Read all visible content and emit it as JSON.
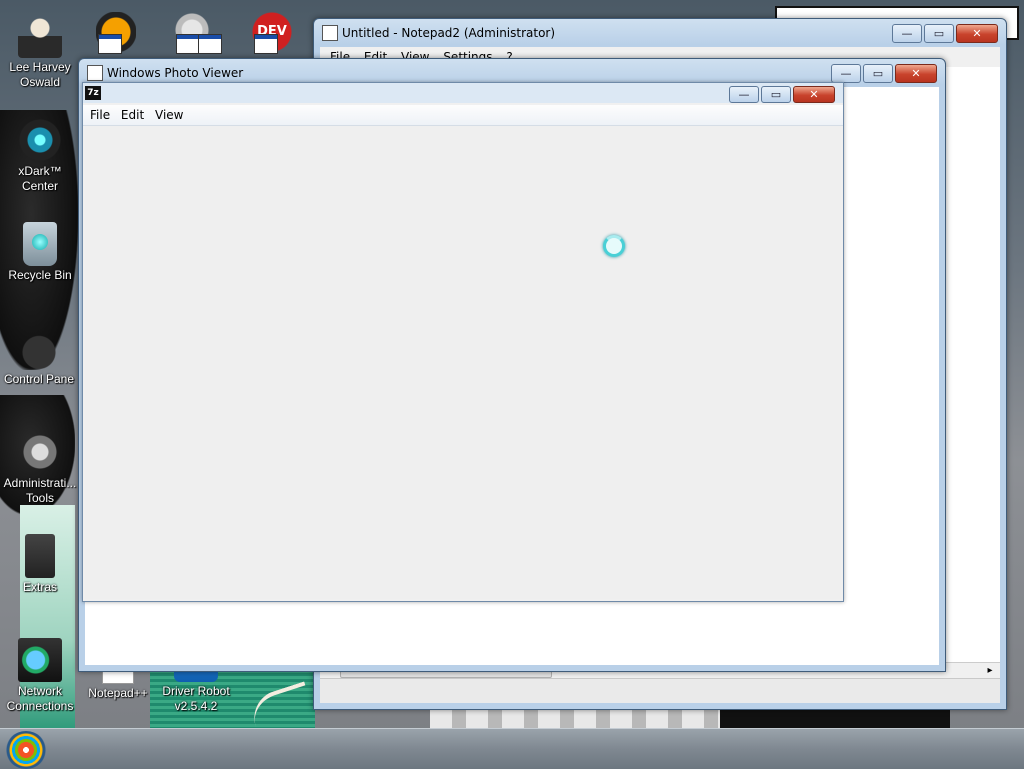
{
  "desktop": {
    "icons": [
      {
        "label": "Lee Harvey Oswald",
        "icon": "person-icon"
      },
      {
        "label": "xDark™ Center",
        "icon": "xdark-icon"
      },
      {
        "label": "Recycle Bin",
        "icon": "recycle-bin-icon"
      },
      {
        "label": "Control Pane",
        "icon": "control-panel-icon"
      },
      {
        "label": "Administrati... Tools",
        "icon": "admin-tools-icon"
      },
      {
        "label": "Extras",
        "icon": "extras-icon"
      },
      {
        "label": "Network Connections",
        "icon": "network-icon"
      },
      {
        "label": "Notepad++",
        "icon": "notepad-plus-icon"
      },
      {
        "label": "Driver Robot v2.5.4.2",
        "icon": "driver-robot-icon"
      }
    ],
    "top_icons": {
      "dev_text": "DEV"
    }
  },
  "notepad": {
    "title": "Untitled - Notepad2 (Administrator)",
    "menu": [
      "File",
      "Edit",
      "View",
      "Settings",
      "?"
    ],
    "scroll_right_arrow": "▸"
  },
  "photo_viewer": {
    "title": "Windows Photo Viewer"
  },
  "sevenzip": {
    "icon_text": "7z",
    "menu": [
      "File",
      "Edit",
      "View"
    ]
  },
  "caption_buttons": {
    "minimize": "—",
    "maximize": "▭",
    "close": "✕"
  }
}
